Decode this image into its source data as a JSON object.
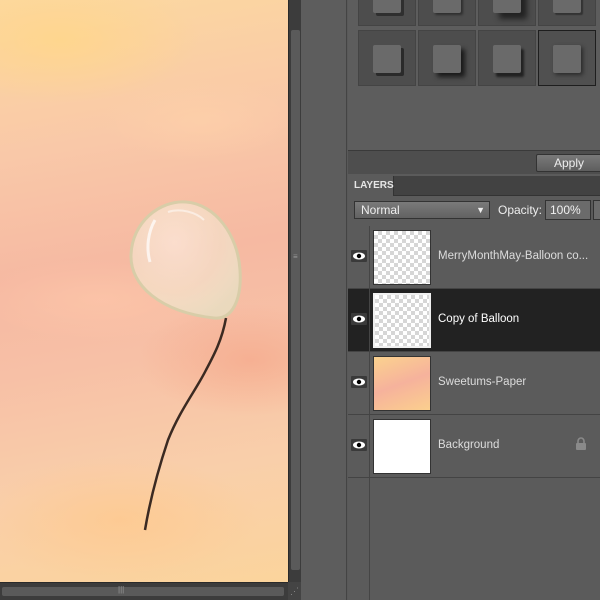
{
  "effects_panel": {
    "apply_label": "Apply",
    "thumbnails": 8,
    "selected_index": 7
  },
  "layers_panel": {
    "tab_label": "LAYERS",
    "blend_mode": "Normal",
    "opacity_label": "Opacity:",
    "opacity_value": "100%",
    "layers": [
      {
        "name": "MerryMonthMay-Balloon co...",
        "thumb": "transparent",
        "visible": true,
        "selected": false,
        "locked": false
      },
      {
        "name": "Copy of Balloon",
        "thumb": "transparent",
        "visible": true,
        "selected": true,
        "locked": false
      },
      {
        "name": "Sweetums-Paper",
        "thumb": "paper",
        "visible": true,
        "selected": false,
        "locked": false
      },
      {
        "name": "Background",
        "thumb": "white",
        "visible": true,
        "selected": false,
        "locked": true
      }
    ]
  },
  "colors": {
    "panel_bg": "#5b5b5b",
    "selected_layer_bg": "#222222",
    "text": "#dcdcdc"
  }
}
